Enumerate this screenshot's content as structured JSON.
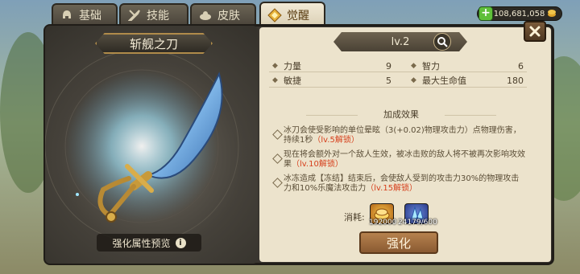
{
  "tabs": [
    {
      "label": "基础",
      "icon": "helmet-icon",
      "active": false
    },
    {
      "label": "技能",
      "icon": "sword-skill-icon",
      "active": false
    },
    {
      "label": "皮肤",
      "icon": "skin-icon",
      "active": false
    },
    {
      "label": "觉醒",
      "icon": "awaken-icon",
      "active": true
    }
  ],
  "currency": {
    "amount": "108,681,058"
  },
  "weapon": {
    "name": "斩舰之刀",
    "preview_label": "强化属性预览"
  },
  "level": {
    "text": "lv.2"
  },
  "stats": [
    {
      "label": "力量",
      "value": "9"
    },
    {
      "label": "智力",
      "value": "6"
    },
    {
      "label": "敏捷",
      "value": "5"
    },
    {
      "label": "最大生命值",
      "value": "180"
    }
  ],
  "effects_title": "加成效果",
  "effects": [
    {
      "text": "冰刀会使受影响的单位晕眩（3(+0.02)物理攻击力）点物理伤害",
      "extra": "，持续1秒",
      "unlock": "（lv.5解锁）"
    },
    {
      "text": "现在将会额外对一个敌人生效，被冰击败的敌人将不被再次影响攻",
      "extra": "效果",
      "unlock": "（lv.10解锁）"
    },
    {
      "text": "冰冻造成【冻结】结束后，会使敌人受到的攻击力30%的物理攻击",
      "extra": "力和10%乐魔法攻击力",
      "unlock": "（lv.15解锁）"
    }
  ],
  "cost": {
    "label": "消耗:",
    "items": [
      {
        "icon": "gold-coins-icon",
        "count": "192000"
      },
      {
        "icon": "blue-crystal-icon",
        "count": "24179/600"
      }
    ]
  },
  "upgrade_button": "强化",
  "colors": {
    "panel_bg": "#ece3cc",
    "accent_red": "#d6401d",
    "button": "#a06d40"
  }
}
